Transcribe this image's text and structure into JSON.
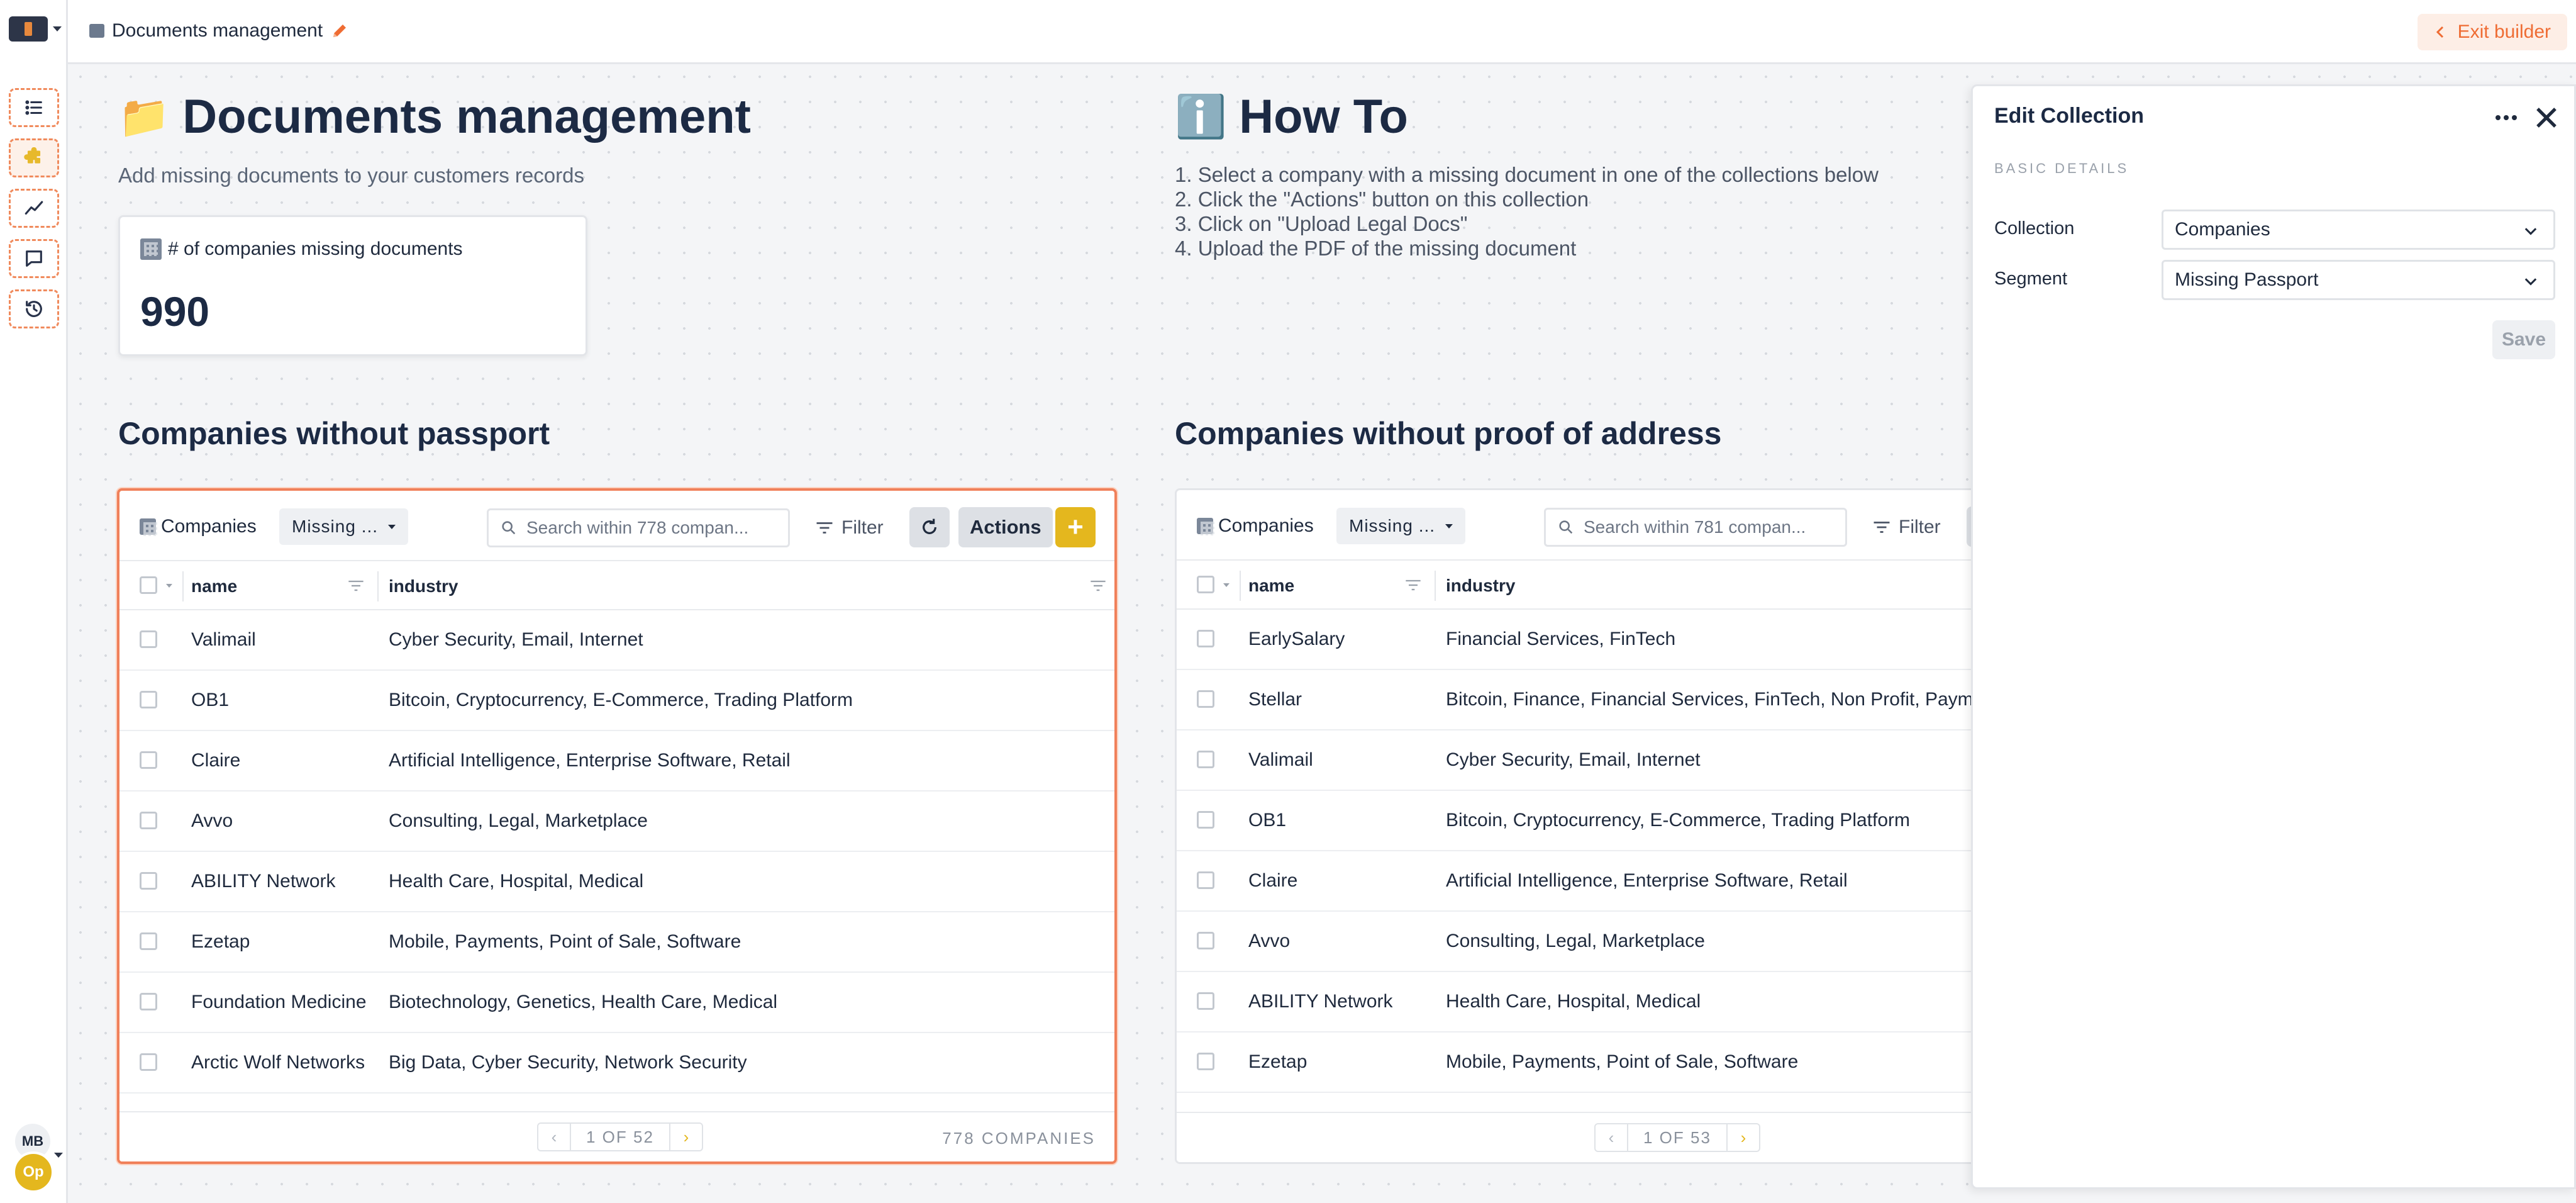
{
  "topbar": {
    "page_name": "Documents management",
    "exit_label": "Exit builder"
  },
  "user": {
    "initials": "MB",
    "org": "Op"
  },
  "main": {
    "title": "Documents management",
    "subtitle": "Add missing documents to your customers records",
    "stat_title": "# of companies missing documents",
    "stat_value": "990"
  },
  "howto": {
    "title": "How To",
    "steps": [
      "1. Select a company with a missing document in one of the collections below",
      "2. Click the \"Actions\" button on this collection",
      "3. Click on \"Upload Legal Docs\"",
      "4. Upload the PDF of the missing document"
    ]
  },
  "table1": {
    "section_title": "Companies without passport",
    "collection": "Companies",
    "segment": "Missing ...",
    "search_placeholder": "Search within 778 compan...",
    "filter_label": "Filter",
    "actions_label": "Actions",
    "columns": [
      "name",
      "industry"
    ],
    "rows": [
      [
        "Valimail",
        "Cyber Security, Email, Internet"
      ],
      [
        "OB1",
        "Bitcoin, Cryptocurrency, E-Commerce, Trading Platform"
      ],
      [
        "Claire",
        "Artificial Intelligence, Enterprise Software, Retail"
      ],
      [
        "Avvo",
        "Consulting, Legal, Marketplace"
      ],
      [
        "ABILITY Network",
        "Health Care, Hospital, Medical"
      ],
      [
        "Ezetap",
        "Mobile, Payments, Point of Sale, Software"
      ],
      [
        "Foundation Medicine",
        "Biotechnology, Genetics, Health Care, Medical"
      ],
      [
        "Arctic Wolf Networks",
        "Big Data, Cyber Security, Network Security"
      ]
    ],
    "page": "1 OF 52",
    "count": "778 COMPANIES"
  },
  "table2": {
    "section_title": "Companies without proof of address",
    "collection": "Companies",
    "segment": "Missing ...",
    "search_placeholder": "Search within 781 compan...",
    "filter_label": "Filter",
    "columns": [
      "name",
      "industry"
    ],
    "rows": [
      [
        "EarlySalary",
        "Financial Services, FinTech"
      ],
      [
        "Stellar",
        "Bitcoin, Finance, Financial Services, FinTech, Non Profit, Payments"
      ],
      [
        "Valimail",
        "Cyber Security, Email, Internet"
      ],
      [
        "OB1",
        "Bitcoin, Cryptocurrency, E-Commerce, Trading Platform"
      ],
      [
        "Claire",
        "Artificial Intelligence, Enterprise Software, Retail"
      ],
      [
        "Avvo",
        "Consulting, Legal, Marketplace"
      ],
      [
        "ABILITY Network",
        "Health Care, Hospital, Medical"
      ],
      [
        "Ezetap",
        "Mobile, Payments, Point of Sale, Software"
      ]
    ],
    "page": "1 OF 53"
  },
  "panel": {
    "title": "Edit Collection",
    "section": "BASIC DETAILS",
    "collection_label": "Collection",
    "collection_value": "Companies",
    "segment_label": "Segment",
    "segment_value": "Missing Passport",
    "save_label": "Save"
  },
  "colors": {
    "accent_orange": "#ef6c33",
    "accent_yellow": "#e4b71e",
    "heading": "#1c2a44"
  }
}
